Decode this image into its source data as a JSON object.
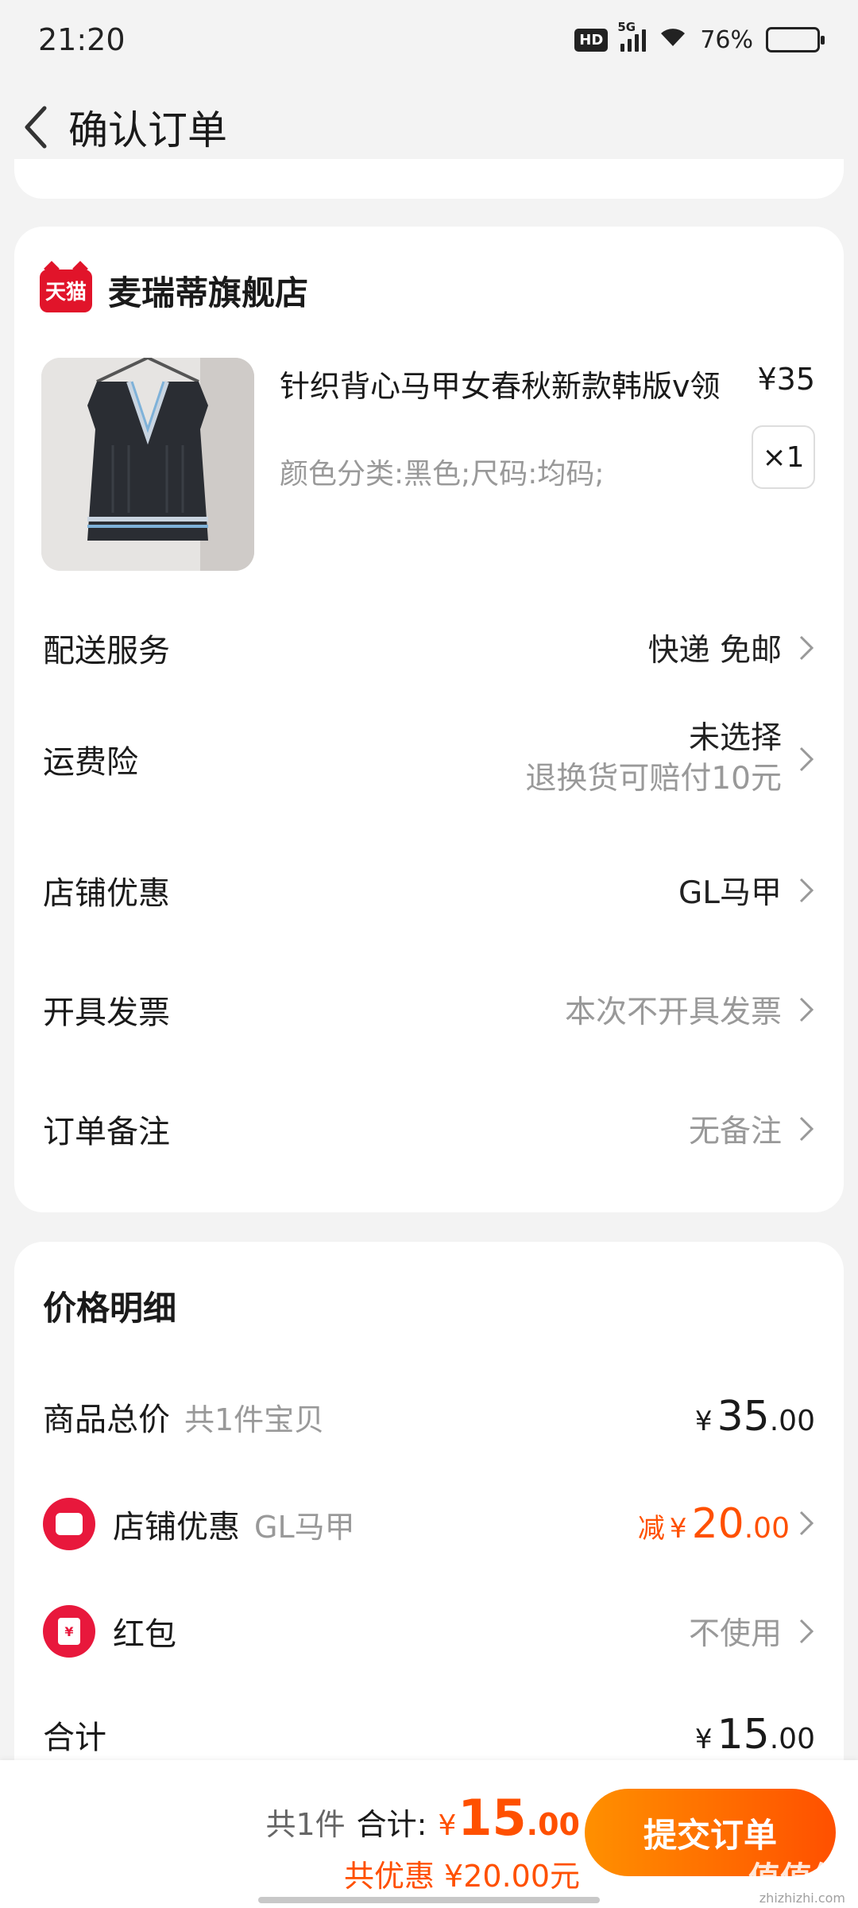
{
  "status_bar": {
    "time": "21:20",
    "network": "5G",
    "hd": "HD",
    "battery_percent": "76%",
    "battery_level": 0.76
  },
  "header": {
    "title": "确认订单"
  },
  "order": {
    "shop": {
      "badge": "天猫",
      "name": "麦瑞蒂旗舰店"
    },
    "product": {
      "title": "针织背心马甲女春秋新款韩版v领",
      "price": "¥35",
      "sku": "颜色分类:黑色;尺码:均码;",
      "quantity": "×1"
    },
    "rows": {
      "delivery": {
        "label": "配送服务",
        "value": "快递 免邮"
      },
      "insurance": {
        "label": "运费险",
        "value": "未选择",
        "note": "退换货可赔付10元"
      },
      "shop_discount": {
        "label": "店铺优惠",
        "value": "GL马甲"
      },
      "invoice": {
        "label": "开具发票",
        "value": "本次不开具发票"
      },
      "remark": {
        "label": "订单备注",
        "value": "无备注"
      }
    }
  },
  "price_detail": {
    "heading": "价格明细",
    "goods_total": {
      "label": "商品总价",
      "sub": "共1件宝贝",
      "currency": "¥",
      "int": "35",
      "dec": ".00"
    },
    "shop_discount": {
      "label": "店铺优惠",
      "sub": "GL马甲",
      "prefix": "减",
      "currency": "¥",
      "int": "20",
      "dec": ".00"
    },
    "red_packet": {
      "label": "红包",
      "value": "不使用",
      "icon_text": "¥"
    },
    "total": {
      "label": "合计",
      "currency": "¥",
      "int": "15",
      "dec": ".00"
    }
  },
  "bottom_bar": {
    "count": "共1件",
    "total_label": "合计:",
    "currency": "¥",
    "total_int": "15",
    "total_dec": ".00",
    "saving": "共优惠 ¥20.00元",
    "submit": "提交订单"
  },
  "watermark": {
    "text": "值值值",
    "sub": "zhizhizhi.com"
  },
  "colors": {
    "accent": "#ff5000",
    "tmall_red": "#e1142a",
    "background": "#f3f3f3"
  }
}
